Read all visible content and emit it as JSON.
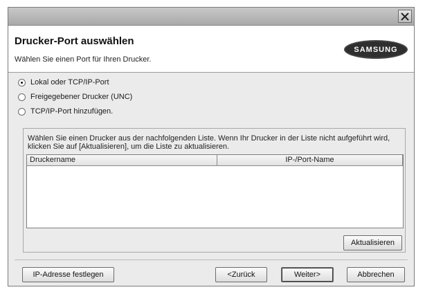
{
  "window": {
    "title": "",
    "close_icon": "close-icon"
  },
  "header": {
    "title": "Drucker-Port auswählen",
    "subtitle": "Wählen Sie einen Port für Ihren Drucker.",
    "logo_text": "SAMSUNG"
  },
  "port_options": {
    "items": [
      {
        "label": "Lokal oder TCP/IP-Port",
        "selected": true
      },
      {
        "label": "Freigegebener Drucker (UNC)",
        "selected": false
      },
      {
        "label": "TCP/IP-Port hinzufügen.",
        "selected": false
      }
    ]
  },
  "printer_list": {
    "description": "Wählen Sie einen Drucker aus der nachfolgenden Liste. Wenn Ihr Drucker in der Liste nicht aufgeführt wird, klicken Sie auf [Aktualisieren], um die Liste zu aktualisieren.",
    "columns": [
      "Druckername",
      "IP-/Port-Name"
    ],
    "rows": []
  },
  "buttons": {
    "refresh": "Aktualisieren",
    "set_ip": "IP-Adresse festlegen",
    "back": "<Zurück",
    "next": "Weiter>",
    "cancel": "Abbrechen"
  }
}
